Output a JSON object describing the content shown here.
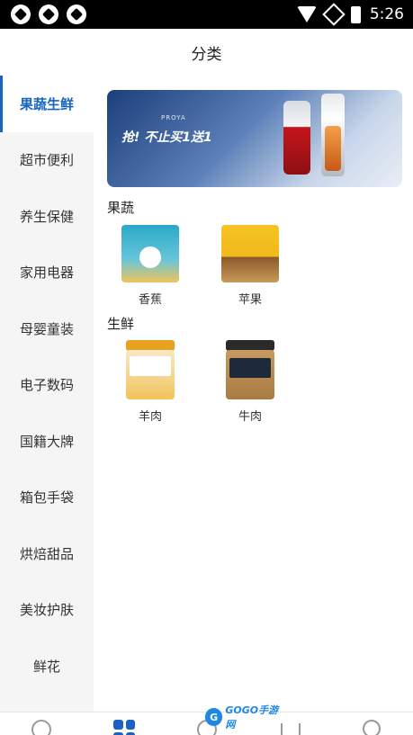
{
  "status_bar": {
    "time": "5:26",
    "notification_icons": [
      "notification-icon",
      "notification-icon",
      "notification-icon"
    ],
    "icons": [
      "wifi-icon",
      "no-signal-icon",
      "battery-icon"
    ]
  },
  "header": {
    "title": "分类"
  },
  "sidebar": {
    "active_index": 0,
    "items": [
      {
        "label": "果蔬生鲜"
      },
      {
        "label": "超市便利"
      },
      {
        "label": "养生保健"
      },
      {
        "label": "家用电器"
      },
      {
        "label": "母婴童装"
      },
      {
        "label": "电子数码"
      },
      {
        "label": "国籍大牌"
      },
      {
        "label": "箱包手袋"
      },
      {
        "label": "烘焙甜品"
      },
      {
        "label": "美妆护肤"
      },
      {
        "label": "鲜花"
      }
    ]
  },
  "banner": {
    "brand": "PROYA",
    "headline": "抢! 不止买1送1"
  },
  "sections": [
    {
      "title": "果蔬",
      "products": [
        {
          "name": "香蕉",
          "image": "snack-bag-teal"
        },
        {
          "name": "苹果",
          "image": "snack-bag-yellow"
        }
      ]
    },
    {
      "title": "生鲜",
      "products": [
        {
          "name": "羊肉",
          "image": "jar-sweet"
        },
        {
          "name": "牛肉",
          "image": "jar-dark"
        }
      ]
    }
  ],
  "tabbar": {
    "active_index": 1,
    "icons": [
      "home-icon",
      "category-grid-icon",
      "compass-icon",
      "cart-icon",
      "user-icon"
    ]
  },
  "watermark": {
    "text": "GOGO手游网"
  },
  "colors": {
    "accent": "#1565c0",
    "sidebar_bg": "#f5f5f5",
    "status_bar": "#000000"
  }
}
